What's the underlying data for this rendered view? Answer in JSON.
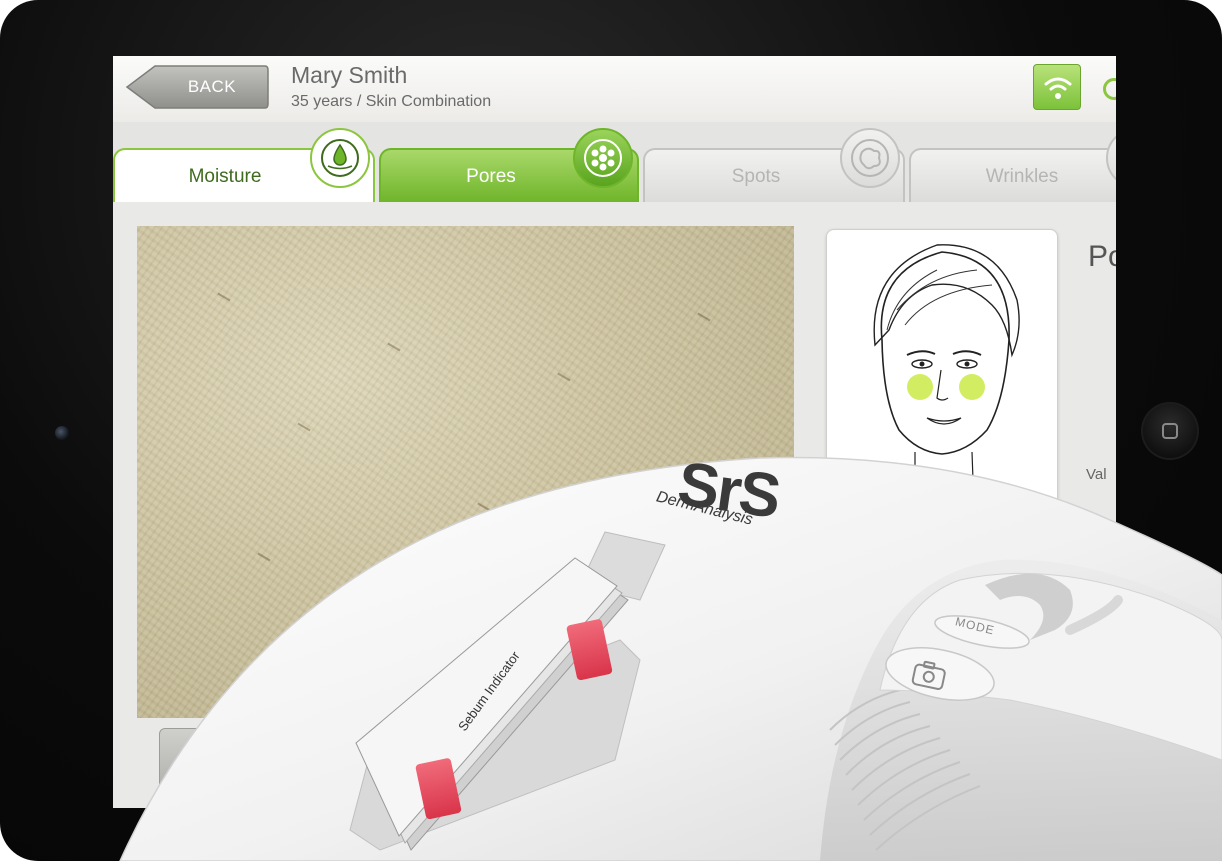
{
  "header": {
    "back_label": "BACK",
    "patient_name": "Mary Smith",
    "patient_info": "35 years / Skin Combination"
  },
  "tabs": [
    {
      "label": "Moisture",
      "icon": "water-drop-icon",
      "state": "selected"
    },
    {
      "label": "Pores",
      "icon": "pores-icon",
      "state": "active"
    },
    {
      "label": "Spots",
      "icon": "spots-icon",
      "state": "inactive"
    },
    {
      "label": "Wrinkles",
      "icon": "wrinkles-icon",
      "state": "inactive"
    }
  ],
  "panel": {
    "title_visible": "Po",
    "value_label_visible": "Val"
  },
  "device": {
    "brand": "SrS",
    "brand_sub": "DermAnalysis",
    "mode_label": "MODE",
    "sebum_label": "Sebum Indicator"
  },
  "colors": {
    "accent_green": "#8cc63f",
    "active_tab_green": "#6fb52a",
    "back_button_gray": "#a9a9a6"
  }
}
